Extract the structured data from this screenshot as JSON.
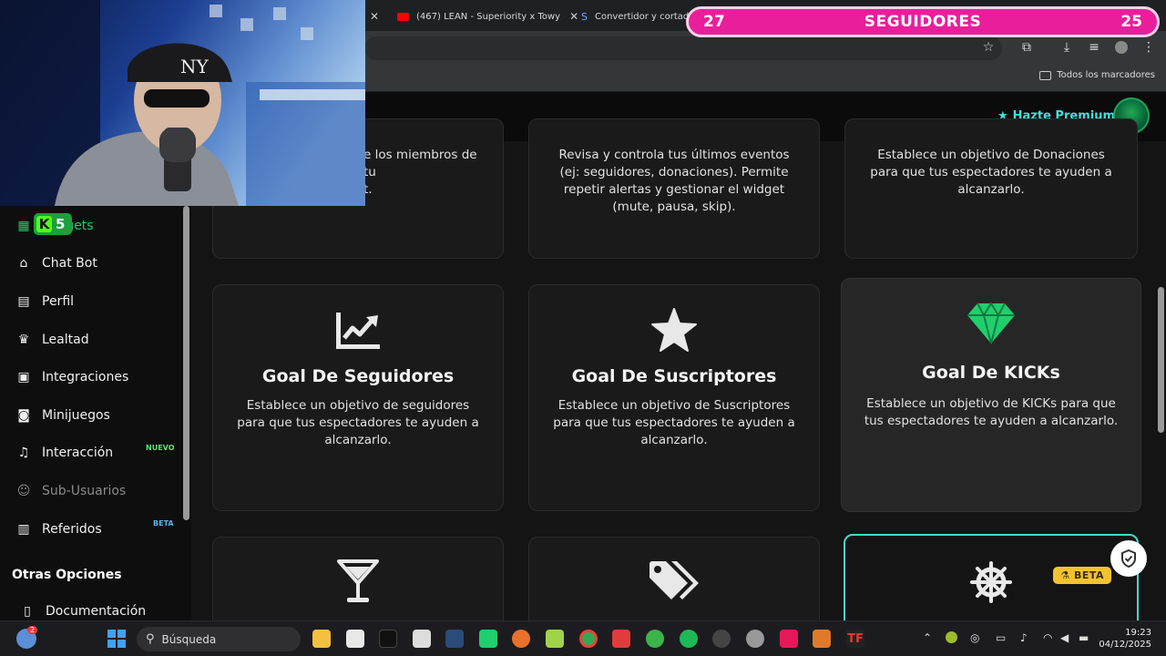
{
  "browser": {
    "tabs": [
      {
        "title": "(467) LEAN - Superiority x Towy",
        "icon": "youtube-icon"
      },
      {
        "title": "Convertidor y cortador",
        "icon": "s-icon"
      }
    ],
    "bookmarks_label": "Todos los marcadores"
  },
  "overlay": {
    "current": "27",
    "label": "SEGUIDORES",
    "goal": "25"
  },
  "header": {
    "premium_label": "Hazte Premium"
  },
  "sidebar": {
    "kick_badge": "5",
    "items": [
      {
        "label": "Widgets",
        "icon": "grid-icon"
      },
      {
        "label": "Chat Bot",
        "icon": "robot-icon"
      },
      {
        "label": "Perfil",
        "icon": "id-card-icon"
      },
      {
        "label": "Lealtad",
        "icon": "trophy-icon"
      },
      {
        "label": "Integraciones",
        "icon": "plug-icon"
      },
      {
        "label": "Minijuegos",
        "icon": "gamepad-icon"
      },
      {
        "label": "Interacción",
        "icon": "music-icon",
        "badge": "NUEVO"
      },
      {
        "label": "Sub-Usuarios",
        "icon": "users-icon"
      },
      {
        "label": "Referidos",
        "icon": "address-card-icon",
        "badge": "BETA"
      }
    ],
    "section_title": "Otras Opciones",
    "docs_label": "Documentación"
  },
  "cards": {
    "top": [
      {
        "desc": "e los miembros de tu\nt."
      },
      {
        "desc": "Revisa y controla tus últimos eventos (ej: seguidores, donaciones). Permite repetir alertas y gestionar el widget (mute, pausa, skip)."
      },
      {
        "desc": "Establece un objetivo de Donaciones para que tus espectadores te ayuden a alcanzarlo."
      }
    ],
    "middle": [
      {
        "title": "Goal De Seguidores",
        "desc": "Establece un objetivo de seguidores para que tus espectadores te ayuden a alcanzarlo.",
        "icon": "chart-line-icon"
      },
      {
        "title": "Goal De Suscriptores",
        "desc": "Establece un objetivo de Suscriptores para que tus espectadores te ayuden a alcanzarlo.",
        "icon": "star-icon"
      },
      {
        "title": "Goal De KICKs",
        "desc": "Establece un objetivo de KICKs para que tus espectadores te ayuden a alcanzarlo.",
        "icon": "gem-icon"
      }
    ],
    "bottom": [
      {
        "icon": "cocktail-icon"
      },
      {
        "icon": "tags-icon"
      },
      {
        "icon": "helm-icon",
        "badge": "BETA"
      }
    ]
  },
  "taskbar": {
    "search_placeholder": "Búsqueda",
    "time": "19:23",
    "date": "04/12/2025",
    "weather_badge": "2"
  },
  "colors": {
    "accent": "#46d9cf",
    "gem": "#1fcf6e",
    "overlay": "#e91e9b",
    "beta": "#f2c230"
  }
}
